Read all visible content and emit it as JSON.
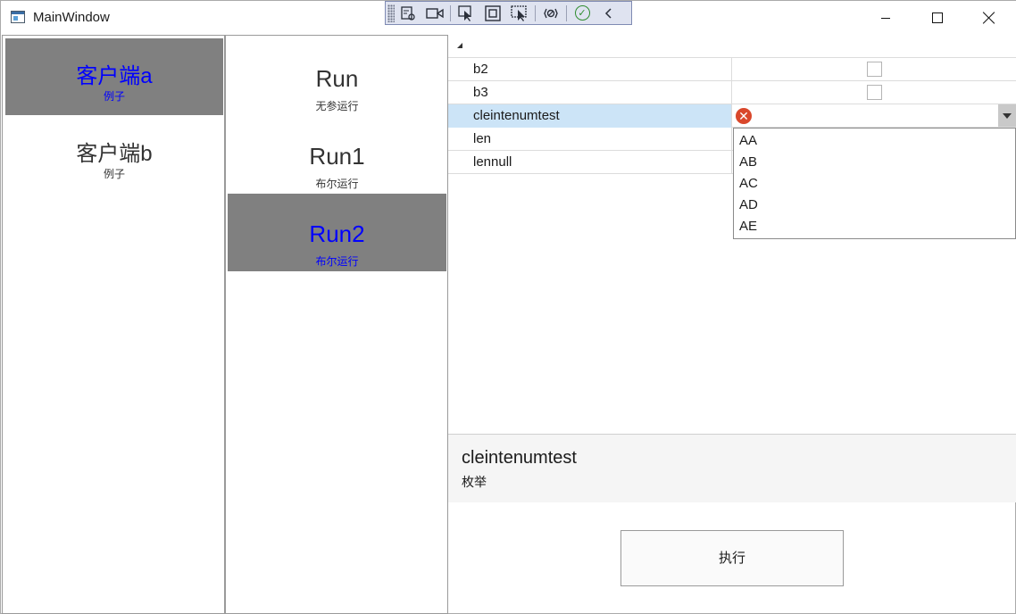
{
  "window": {
    "title": "MainWindow"
  },
  "debug_toolbar": {
    "icons": [
      "select-element-icon",
      "record-icon",
      "pointer-select-icon",
      "layout-adorner-icon",
      "track-focus-icon",
      "binding-failures-icon",
      "check-icon",
      "collapse-chevron-icon"
    ]
  },
  "clients": [
    {
      "name": "客户端a",
      "sub": "例子",
      "selected": true
    },
    {
      "name": "客户端b",
      "sub": "例子",
      "selected": false
    }
  ],
  "runs": [
    {
      "name": "Run",
      "sub": "无参运行",
      "selected": false
    },
    {
      "name": "Run1",
      "sub": "布尔运行",
      "selected": false
    },
    {
      "name": "Run2",
      "sub": "布尔运行",
      "selected": true
    }
  ],
  "property_grid": {
    "rows": [
      {
        "name": "b2",
        "editor": "checkbox",
        "checked": false
      },
      {
        "name": "b3",
        "editor": "checkbox",
        "checked": false
      },
      {
        "name": "cleintenumtest",
        "editor": "combobox",
        "has_error": true,
        "selected": true
      },
      {
        "name": "len",
        "editor": "text"
      },
      {
        "name": "lennull",
        "editor": "text"
      }
    ],
    "dropdown_options": [
      "AA",
      "AB",
      "AC",
      "AD",
      "AE"
    ]
  },
  "description": {
    "title": "cleintenumtest",
    "text": "枚举"
  },
  "execute_button": {
    "label": "执行"
  },
  "colors": {
    "selected_item_bg": "#808080",
    "selected_item_text": "#0000ff",
    "selected_row_bg": "#cce4f7",
    "error_icon": "#d9472b"
  }
}
